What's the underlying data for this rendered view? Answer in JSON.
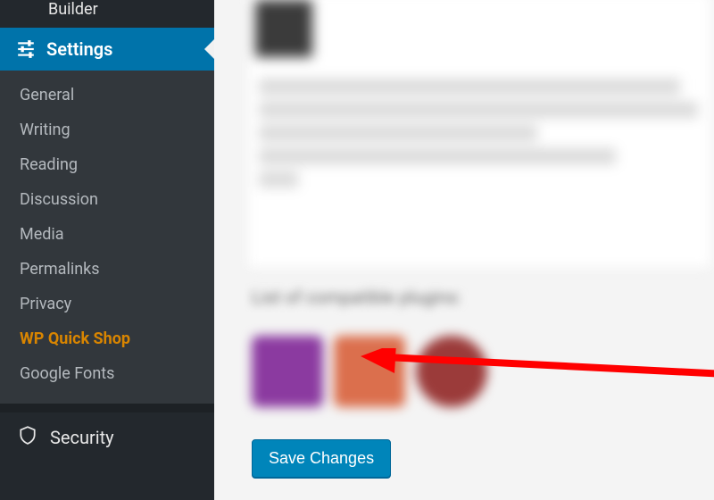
{
  "sidebar": {
    "pre_item": "Builder",
    "settings_label": "Settings",
    "items": [
      {
        "label": "General"
      },
      {
        "label": "Writing"
      },
      {
        "label": "Reading"
      },
      {
        "label": "Discussion"
      },
      {
        "label": "Media"
      },
      {
        "label": "Permalinks"
      },
      {
        "label": "Privacy"
      },
      {
        "label": "WP Quick Shop",
        "current": true
      },
      {
        "label": "Google Fonts"
      }
    ],
    "security_label": "Security"
  },
  "content": {
    "section_heading": "List of compatible plugins:",
    "save_button": "Save Changes"
  },
  "colors": {
    "sidebar_bg": "#23282d",
    "submenu_bg": "#32373c",
    "accent": "#0073aa",
    "highlight": "#d98500",
    "button": "#0085ba"
  }
}
